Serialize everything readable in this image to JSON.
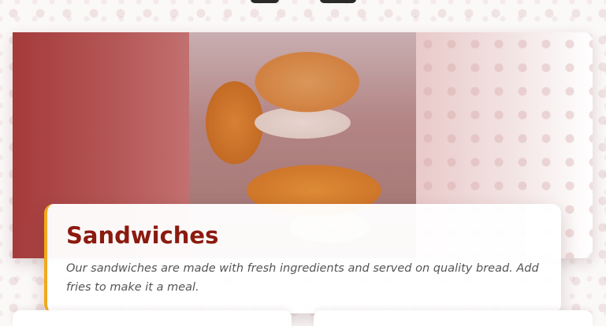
{
  "category": {
    "title": "Sandwiches",
    "description": "Our sandwiches are made with fresh ingredients and served on quality bread. Add fries to make it a meal.",
    "image": {
      "alt": "Fried chicken sandwich"
    }
  },
  "colors": {
    "title": "#8b1a0f",
    "accent_border": "#f2a81d",
    "hero_left": "#a53b3b"
  }
}
